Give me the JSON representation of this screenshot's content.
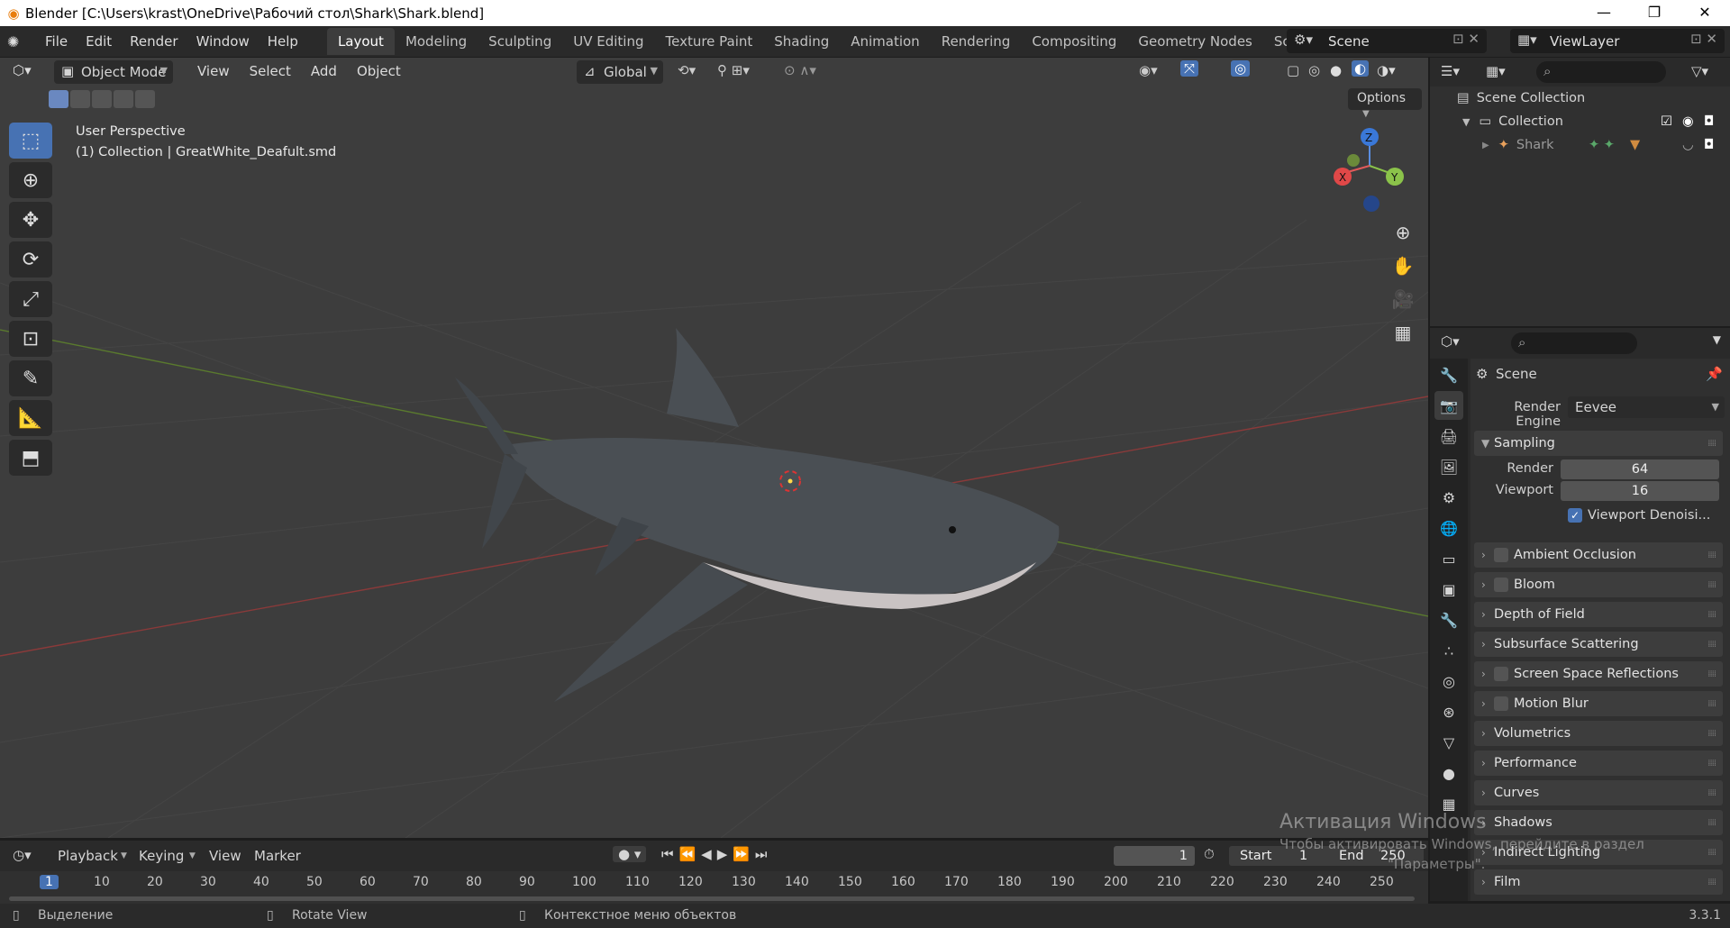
{
  "window": {
    "title": "Blender [C:\\Users\\krast\\OneDrive\\Рабочий стол\\Shark\\Shark.blend]",
    "minimize": "—",
    "maximize": "❐",
    "close": "✕"
  },
  "topbar": {
    "menus": [
      "File",
      "Edit",
      "Render",
      "Window",
      "Help"
    ],
    "workspaces": [
      "Layout",
      "Modeling",
      "Sculpting",
      "UV Editing",
      "Texture Paint",
      "Shading",
      "Animation",
      "Rendering",
      "Compositing",
      "Geometry Nodes",
      "Scripting"
    ],
    "active_workspace": "Layout",
    "add_workspace": "+",
    "scene": "Scene",
    "view_layer": "ViewLayer"
  },
  "viewport": {
    "mode": "Object Mode",
    "menus": [
      "View",
      "Select",
      "Add",
      "Object"
    ],
    "orientation": "Global",
    "options": "Options",
    "perspective_label": "User Perspective",
    "collection_label": "(1) Collection | GreatWhite_Deafult.smd",
    "gizmo_axis_z": "Z",
    "gizmo_axis_y": "Y",
    "gizmo_axis_x": "X"
  },
  "outliner": {
    "scene_collection": "Scene Collection",
    "collection": "Collection",
    "object": "Shark"
  },
  "properties": {
    "scene_title": "Scene",
    "render_engine_label": "Render Engine",
    "render_engine": "Eevee",
    "sampling": "Sampling",
    "render_label": "Render",
    "render_samples": "64",
    "viewport_label": "Viewport",
    "viewport_samples": "16",
    "viewport_denoise": "Viewport Denoisi...",
    "panels": [
      "Ambient Occlusion",
      "Bloom",
      "Depth of Field",
      "Subsurface Scattering",
      "Screen Space Reflections",
      "Motion Blur",
      "Volumetrics",
      "Performance",
      "Curves",
      "Shadows",
      "Indirect Lighting",
      "Film"
    ]
  },
  "timeline": {
    "menus": [
      "Playback",
      "Keying",
      "View",
      "Marker"
    ],
    "current_frame": "1",
    "start_label": "Start",
    "start": "1",
    "end_label": "End",
    "end": "250",
    "ticks": [
      "1",
      "10",
      "20",
      "30",
      "40",
      "50",
      "60",
      "70",
      "80",
      "90",
      "100",
      "110",
      "120",
      "130",
      "140",
      "150",
      "160",
      "170",
      "180",
      "190",
      "200",
      "210",
      "220",
      "230",
      "240",
      "250"
    ]
  },
  "statusbar": {
    "select": "Выделение",
    "rotate": "Rotate View",
    "context": "Контекстное меню объектов",
    "version": "3.3.1"
  },
  "watermark": {
    "line1": "Активация Windows",
    "line2": "Чтобы активировать Windows, перейдите в раздел",
    "line3": "\"Параметры\"."
  }
}
